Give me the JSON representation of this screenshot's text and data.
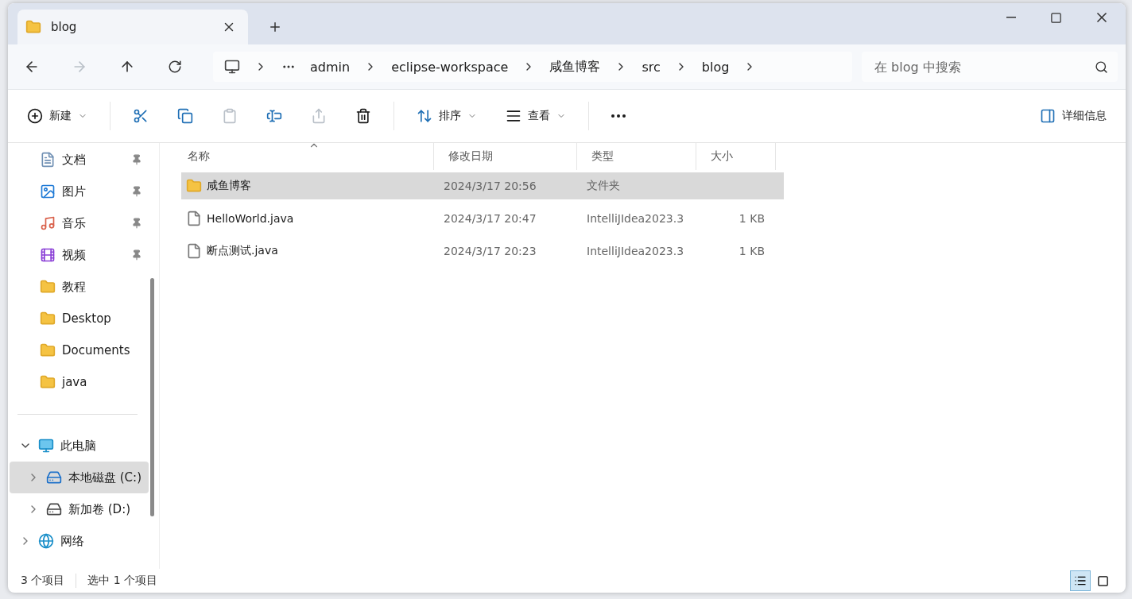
{
  "tab": {
    "title": "blog"
  },
  "nav": {
    "back_disabled": false,
    "forward_disabled": true
  },
  "breadcrumbs": [
    "admin",
    "eclipse-workspace",
    "咸鱼博客",
    "src",
    "blog"
  ],
  "search": {
    "placeholder": "在 blog 中搜索"
  },
  "toolbar": [
    {
      "kind": "new",
      "label": "新建",
      "disabled": false
    },
    {
      "kind": "cut",
      "disabled": false
    },
    {
      "kind": "copy",
      "disabled": false
    },
    {
      "kind": "paste",
      "disabled": true
    },
    {
      "kind": "rename",
      "disabled": false
    },
    {
      "kind": "share",
      "disabled": true
    },
    {
      "kind": "delete",
      "disabled": false
    },
    {
      "kind": "sort",
      "label": "排序",
      "disabled": false
    },
    {
      "kind": "view",
      "label": "查看",
      "disabled": false
    },
    {
      "kind": "more",
      "disabled": false
    }
  ],
  "details_button": {
    "label": "详细信息"
  },
  "sidebar": [
    {
      "kind": "documents",
      "label": "文档",
      "pinned": true,
      "selected": false
    },
    {
      "kind": "pictures",
      "label": "图片",
      "pinned": true,
      "selected": false
    },
    {
      "kind": "music",
      "label": "音乐",
      "pinned": true,
      "selected": false
    },
    {
      "kind": "videos",
      "label": "视频",
      "pinned": true,
      "selected": false
    },
    {
      "kind": "folder",
      "label": "教程",
      "pinned": false,
      "selected": false
    },
    {
      "kind": "folder",
      "label": "Desktop",
      "pinned": false,
      "selected": false
    },
    {
      "kind": "folder",
      "label": "Documents",
      "pinned": false,
      "selected": false
    },
    {
      "kind": "folder",
      "label": "java",
      "pinned": false,
      "selected": false
    }
  ],
  "tree": [
    {
      "kind": "pc",
      "label": "此电脑",
      "expanded": true,
      "selected": false,
      "children": [
        {
          "kind": "system-drive",
          "label": "本地磁盘 (C:)",
          "expanded": false,
          "selected": true
        },
        {
          "kind": "drive",
          "label": "新加卷 (D:)",
          "expanded": false,
          "selected": false
        }
      ]
    },
    {
      "kind": "network",
      "label": "网络",
      "expanded": false,
      "selected": false
    }
  ],
  "columns": [
    {
      "label": "名称",
      "sorted": true
    },
    {
      "label": "修改日期",
      "sorted": false
    },
    {
      "label": "类型",
      "sorted": false
    },
    {
      "label": "大小",
      "sorted": false
    }
  ],
  "rows": [
    {
      "kind": "folder",
      "name": "咸鱼博客",
      "modified": "2024/3/17 20:56",
      "type": "文件夹",
      "selected": true
    },
    {
      "kind": "file",
      "name": "HelloWorld.java",
      "modified": "2024/3/17 20:47",
      "type": "IntelliJIdea2023.3",
      "size": "1 KB",
      "selected": false
    },
    {
      "kind": "file",
      "name": "断点测试.java",
      "modified": "2024/3/17 20:23",
      "type": "IntelliJIdea2023.3",
      "size": "1 KB",
      "selected": false
    }
  ],
  "status_bar": {
    "count": "3 个项目",
    "selection": "选中 1 个项目"
  },
  "view_toggle": [
    {
      "kind": "details",
      "selected": true
    },
    {
      "kind": "tiles",
      "selected": false
    }
  ]
}
